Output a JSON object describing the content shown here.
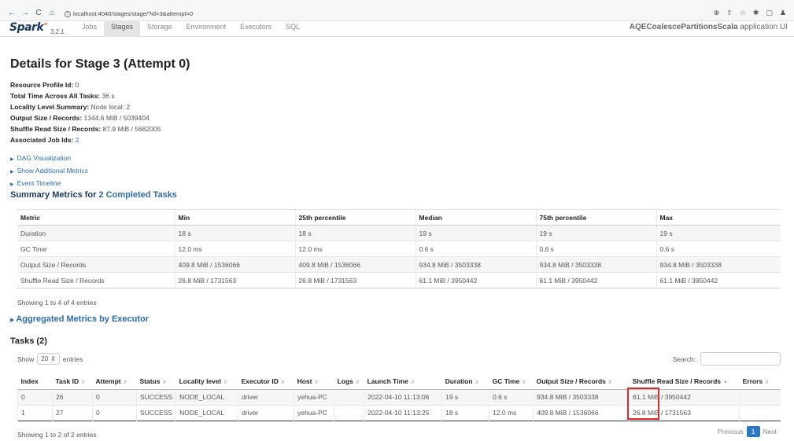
{
  "browser": {
    "nav_icons": [
      "←",
      "→",
      "C",
      "⌂"
    ],
    "url": "localhost:4040/stages/stage/?id=3&attempt=0",
    "right_icons": [
      "⊕",
      "⇪",
      "☆",
      "✱",
      "▢",
      "♟"
    ]
  },
  "navbar": {
    "logo": "Spark",
    "version": "3.2.1",
    "tabs": [
      "Jobs",
      "Stages",
      "Storage",
      "Environment",
      "Executors",
      "SQL"
    ],
    "active_tab": "Stages",
    "app_name": "AQECoalescePartitionsScala",
    "app_suffix": " application UI"
  },
  "page": {
    "title": "Details for Stage 3 (Attempt 0)"
  },
  "details": [
    {
      "label": "Resource Profile Id:",
      "value": " 0"
    },
    {
      "label": "Total Time Across All Tasks:",
      "value": " 36 s"
    },
    {
      "label": "Locality Level Summary:",
      "value": " Node local: 2"
    },
    {
      "label": "Output Size / Records:",
      "value": " 1344.6 MiB / 5039404"
    },
    {
      "label": "Shuffle Read Size / Records:",
      "value": " 87.9 MiB / 5682005"
    },
    {
      "label": "Associated Job Ids:",
      "value": "2"
    }
  ],
  "toggles": [
    "DAG Visualization",
    "Show Additional Metrics",
    "Event Timeline"
  ],
  "summary": {
    "title_prefix": "Summary Metrics for ",
    "title_link": "2 Completed Tasks",
    "headers": [
      "Metric",
      "Min",
      "25th percentile",
      "Median",
      "75th percentile",
      "Max"
    ],
    "rows": [
      [
        "Duration",
        "18 s",
        "18 s",
        "19 s",
        "19 s",
        "19 s"
      ],
      [
        "GC Time",
        "12.0 ms",
        "12.0 ms",
        "0.6 s",
        "0.6 s",
        "0.6 s"
      ],
      [
        "Output Size / Records",
        "409.8 MiB / 1536066",
        "409.8 MiB / 1536066",
        "934.8 MiB / 3503338",
        "934.8 MiB / 3503338",
        "934.8 MiB / 3503338"
      ],
      [
        "Shuffle Read Size / Records",
        "26.8 MiB / 1731563",
        "26.8 MiB / 1731563",
        "61.1 MiB / 3950442",
        "61.1 MiB / 3950442",
        "61.1 MiB / 3950442"
      ]
    ],
    "showing": "Showing 1 to 4 of 4 entries"
  },
  "aggregated": {
    "title": "Aggregated Metrics by Executor"
  },
  "tasks": {
    "title": "Tasks (2)",
    "show_label": "Show",
    "page_size": "20",
    "entries_label": "entries",
    "search_label": "Search:",
    "headers": [
      "Index",
      "Task ID",
      "Attempt",
      "Status",
      "Locality level",
      "Executor ID",
      "Host",
      "Logs",
      "Launch Time",
      "Duration",
      "GC Time",
      "Output Size / Records",
      "Shuffle Read Size / Records",
      "Errors"
    ],
    "rows": [
      [
        "0",
        "26",
        "0",
        "SUCCESS",
        "NODE_LOCAL",
        "driver",
        "yehua-PC",
        "",
        "2022-04-10 11:13:06",
        "19 s",
        "0.6 s",
        "934.8 MiB / 3503338",
        "61.1 MiB / 3950442",
        ""
      ],
      [
        "1",
        "27",
        "0",
        "SUCCESS",
        "NODE_LOCAL",
        "driver",
        "yehua-PC",
        "",
        "2022-04-10 11:13:25",
        "18 s",
        "12.0 ms",
        "409.8 MiB / 1536066",
        "26.8 MiB / 1731563",
        ""
      ]
    ],
    "showing": "Showing 1 to 2 of 2 entries",
    "pager": {
      "prev": "Previous",
      "current": "1",
      "next": "Next"
    }
  },
  "colors": {
    "accent": "#2b79c2",
    "highlight": "#d92c2c",
    "title": "#1d3a63"
  }
}
